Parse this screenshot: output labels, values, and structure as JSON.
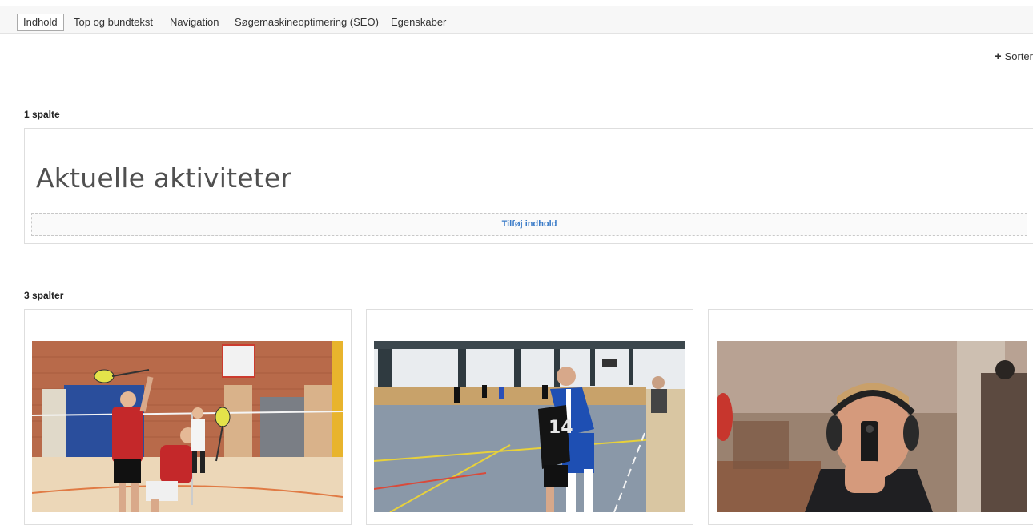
{
  "tabs": [
    {
      "label": "Indhold",
      "active": true
    },
    {
      "label": "Top og bundtekst",
      "active": false
    },
    {
      "label": "Navigation",
      "active": false
    },
    {
      "label": "Søgemaskineoptimering (SEO)",
      "active": false
    },
    {
      "label": "Egenskaber",
      "active": false
    }
  ],
  "toolbar": {
    "sort_label": "Sorter",
    "sort_icon": "plus-icon"
  },
  "section_one": {
    "label": "1 spalte",
    "heading": "Aktuelle aktiviteter",
    "add_content_label": "Tilføj indhold"
  },
  "section_three": {
    "label": "3 spalter",
    "columns": [
      {
        "image": "badminton-photo"
      },
      {
        "image": "indoor-football-photo"
      },
      {
        "image": "pistol-shooting-photo"
      }
    ]
  }
}
